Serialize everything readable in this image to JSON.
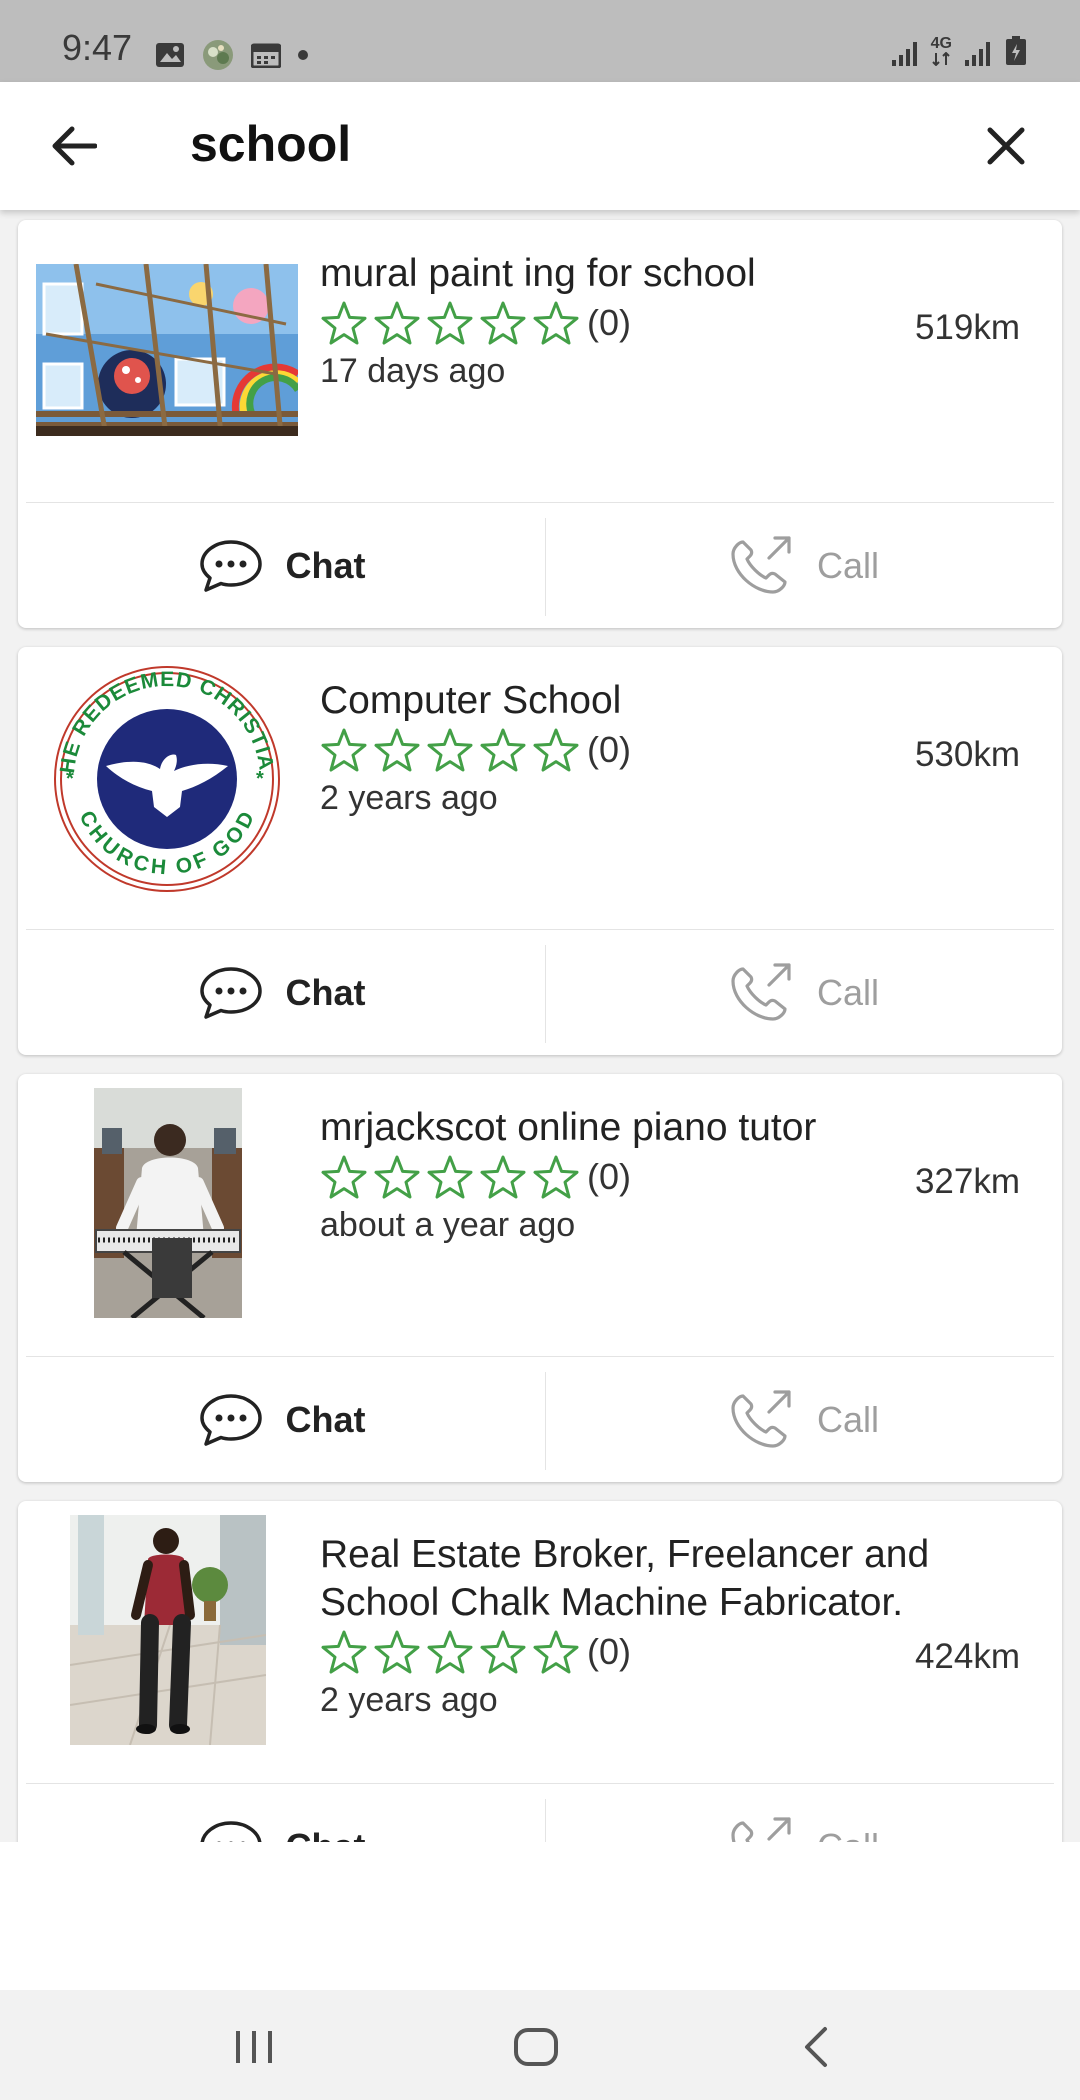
{
  "status_bar": {
    "time": "9:47",
    "network_label": "4G",
    "icons": [
      "image-icon",
      "app-icon",
      "calendar-icon",
      "dot-icon",
      "signal-icon",
      "4g-icon",
      "signal-icon",
      "battery-icon"
    ]
  },
  "header": {
    "search_query": "school",
    "back_icon": "arrow-left-icon",
    "close_icon": "close-icon"
  },
  "results": [
    {
      "title": "mural paint ing for school",
      "rating_count": "(0)",
      "rating_stars": 0,
      "distance": "519km",
      "posted": "17 days ago",
      "chat_label": "Chat",
      "call_label": "Call"
    },
    {
      "title": "Computer School",
      "rating_count": "(0)",
      "rating_stars": 0,
      "distance": "530km",
      "posted": "2 years ago",
      "chat_label": "Chat",
      "call_label": "Call",
      "logo_text_top": "THE REDEEMED CHRISTIAN",
      "logo_text_bottom": "CHURCH OF GOD"
    },
    {
      "title": "mrjackscot online piano tutor",
      "rating_count": "(0)",
      "rating_stars": 0,
      "distance": "327km",
      "posted": "about a year ago",
      "chat_label": "Chat",
      "call_label": "Call"
    },
    {
      "title": "Real Estate Broker, Freelancer and School Chalk Machine Fabricator.",
      "rating_count": "(0)",
      "rating_stars": 0,
      "distance": "424km",
      "posted": "2 years ago",
      "chat_label": "Chat",
      "call_label": "Call"
    }
  ],
  "colors": {
    "star": "#43a047",
    "logo_green": "#1b8a3a",
    "logo_blue": "#1f2a7a",
    "logo_red": "#c0392b",
    "call_gray": "#9e9e9e"
  },
  "nav_bar": {
    "icons": [
      "recent-apps-icon",
      "home-icon",
      "back-icon"
    ]
  }
}
